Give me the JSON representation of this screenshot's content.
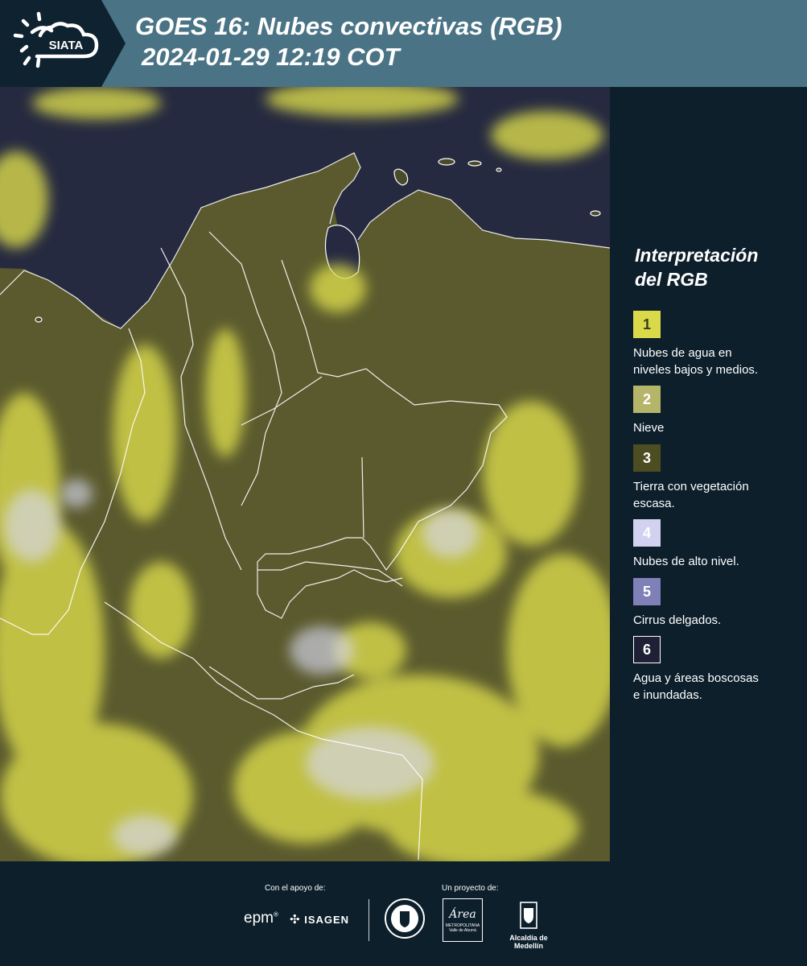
{
  "header": {
    "logo_text": "SIATA",
    "title_line1": "GOES 16: Nubes convectivas (RGB)",
    "title_line2": "2024-01-29 12:19 COT"
  },
  "legend": {
    "title_line1": "Interpretación",
    "title_line2": "del RGB",
    "items": [
      {
        "number": "1",
        "label_lines": [
          "Nubes de agua en",
          "niveles bajos y medios."
        ],
        "color": "#d9d94a",
        "text_color": "#3a3a20"
      },
      {
        "number": "2",
        "label_lines": [
          "Nieve"
        ],
        "color": "#b5b56a",
        "text_color": "#ffffff"
      },
      {
        "number": "3",
        "label_lines": [
          "Tierra con vegetación",
          "escasa."
        ],
        "color": "#4d4d22",
        "text_color": "#ffffff"
      },
      {
        "number": "4",
        "label_lines": [
          "Nubes de alto nivel."
        ],
        "color": "#d2d2f0",
        "text_color": "#ffffff"
      },
      {
        "number": "5",
        "label_lines": [
          "Cirrus delgados."
        ],
        "color": "#8080b8",
        "text_color": "#ffffff"
      },
      {
        "number": "6",
        "label_lines": [
          "Agua y áreas boscosas",
          "e inundadas."
        ],
        "color": "#1f1f35",
        "text_color": "#ffffff"
      }
    ]
  },
  "footer": {
    "support_label": "Con el apoyo de:",
    "project_label": "Un proyecto de:",
    "logo_epm": "epm",
    "logo_isagen": "ISAGEN",
    "logo_area_word": "Área",
    "logo_area_sub1": "METROPOLITANA",
    "logo_area_sub2": "Valle de Aburrá",
    "logo_alcaldia": "Alcaldía de Medellín"
  },
  "colors": {
    "header_bg": "#4a7485",
    "panel_bg": "#0c1f2b",
    "ocean": "#262a40",
    "land": "#5c5c2c",
    "cloud_yellow": "#dede50",
    "cloud_white": "#d8d8ee",
    "border": "#ffffff"
  }
}
